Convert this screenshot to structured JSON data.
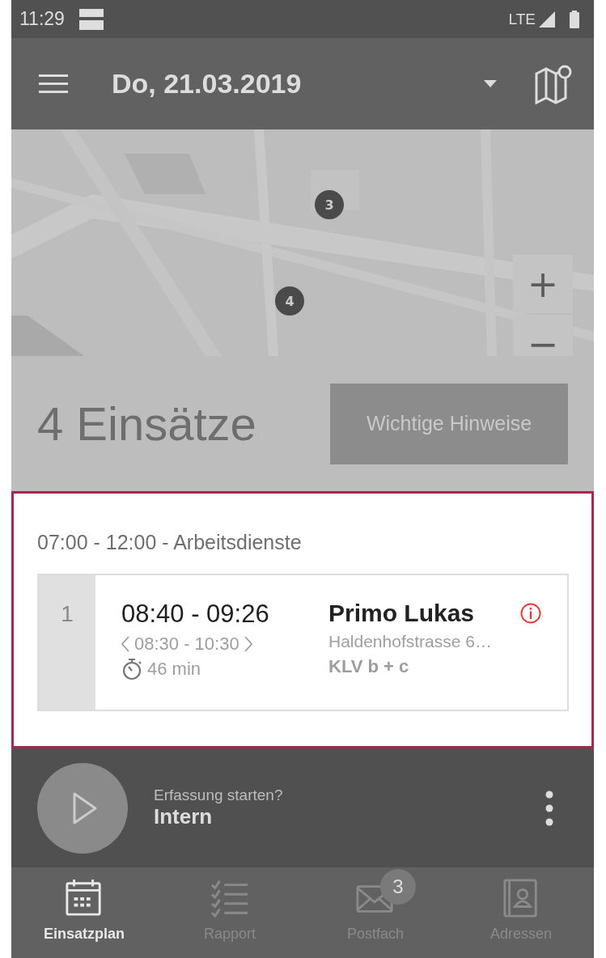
{
  "status_bar": {
    "time": "11:29",
    "network": "LTE"
  },
  "app_bar": {
    "date": "Do, 21.03.2019"
  },
  "map": {
    "kind": "picture",
    "markers": [
      "3",
      "4"
    ],
    "zoom_in": "+",
    "zoom_out": "−"
  },
  "summary": {
    "count": "4 Einsätze",
    "button": "Wichtige Hinweise"
  },
  "block": {
    "title": "07:00 - 12:00 - Arbeitsdienste",
    "jobs": [
      {
        "number": "1",
        "time": "08:40 - 09:26",
        "window": "08:30 - 10:30",
        "duration": "46 min",
        "client": "Primo Lukas",
        "address": "Haldenhofstrasse 6…",
        "service": "KLV b + c",
        "info": true
      }
    ]
  },
  "tracking": {
    "prompt": "Erfassung starten?",
    "name": "Intern"
  },
  "tabs": [
    {
      "label": "Einsatzplan",
      "kind": "calendar",
      "selected": true
    },
    {
      "label": "Rapport",
      "kind": "checklist",
      "selected": false
    },
    {
      "label": "Postfach",
      "kind": "mail",
      "selected": false,
      "badge": "3"
    },
    {
      "label": "Adressen",
      "kind": "contacts",
      "selected": false
    }
  ]
}
